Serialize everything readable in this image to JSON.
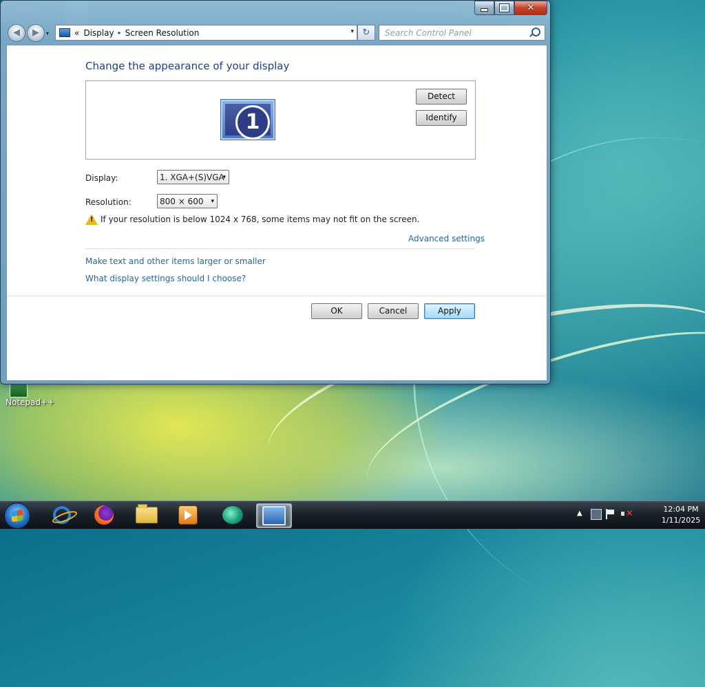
{
  "window": {
    "address": {
      "root_glyph": "«",
      "segments": [
        "Display",
        "Screen Resolution"
      ],
      "separator_glyph": "▸",
      "dropdown_glyph": "▾"
    },
    "refresh_glyph": "↻",
    "search": {
      "placeholder": "Search Control Panel"
    },
    "caption": {
      "minimize": "minimize",
      "maximize": "maximize",
      "close_glyph": "✕"
    },
    "nav": {
      "back_glyph": "◀",
      "forward_glyph": "▶",
      "recent_glyph": "▾"
    }
  },
  "content": {
    "title": "Change the appearance of your display",
    "monitor_number": "1",
    "detect_label": "Detect",
    "identify_label": "Identify",
    "display_label": "Display:",
    "display_value": "1. XGA+(S)VGA",
    "resolution_label": "Resolution:",
    "resolution_value": "800 × 600",
    "combo_arrow": "▾",
    "warning_glyph": "!",
    "warning_text": "If your resolution is below 1024 x 768, some items may not fit on the screen.",
    "advanced_link": "Advanced settings",
    "links": [
      "Make text and other items larger or smaller",
      "What display settings should I choose?"
    ],
    "buttons": {
      "ok": "OK",
      "cancel": "Cancel",
      "apply": "Apply"
    }
  },
  "desktop": {
    "icon_label": "Notepad++"
  },
  "taskbar": {
    "apps": [
      "internet-explorer-icon",
      "firefox-icon",
      "folder-icon",
      "media-player-icon",
      "meeting-icon",
      "control-panel-icon"
    ],
    "tray": {
      "up_glyph": "▲",
      "time": "12:04 PM",
      "date": "1/11/2025"
    }
  }
}
